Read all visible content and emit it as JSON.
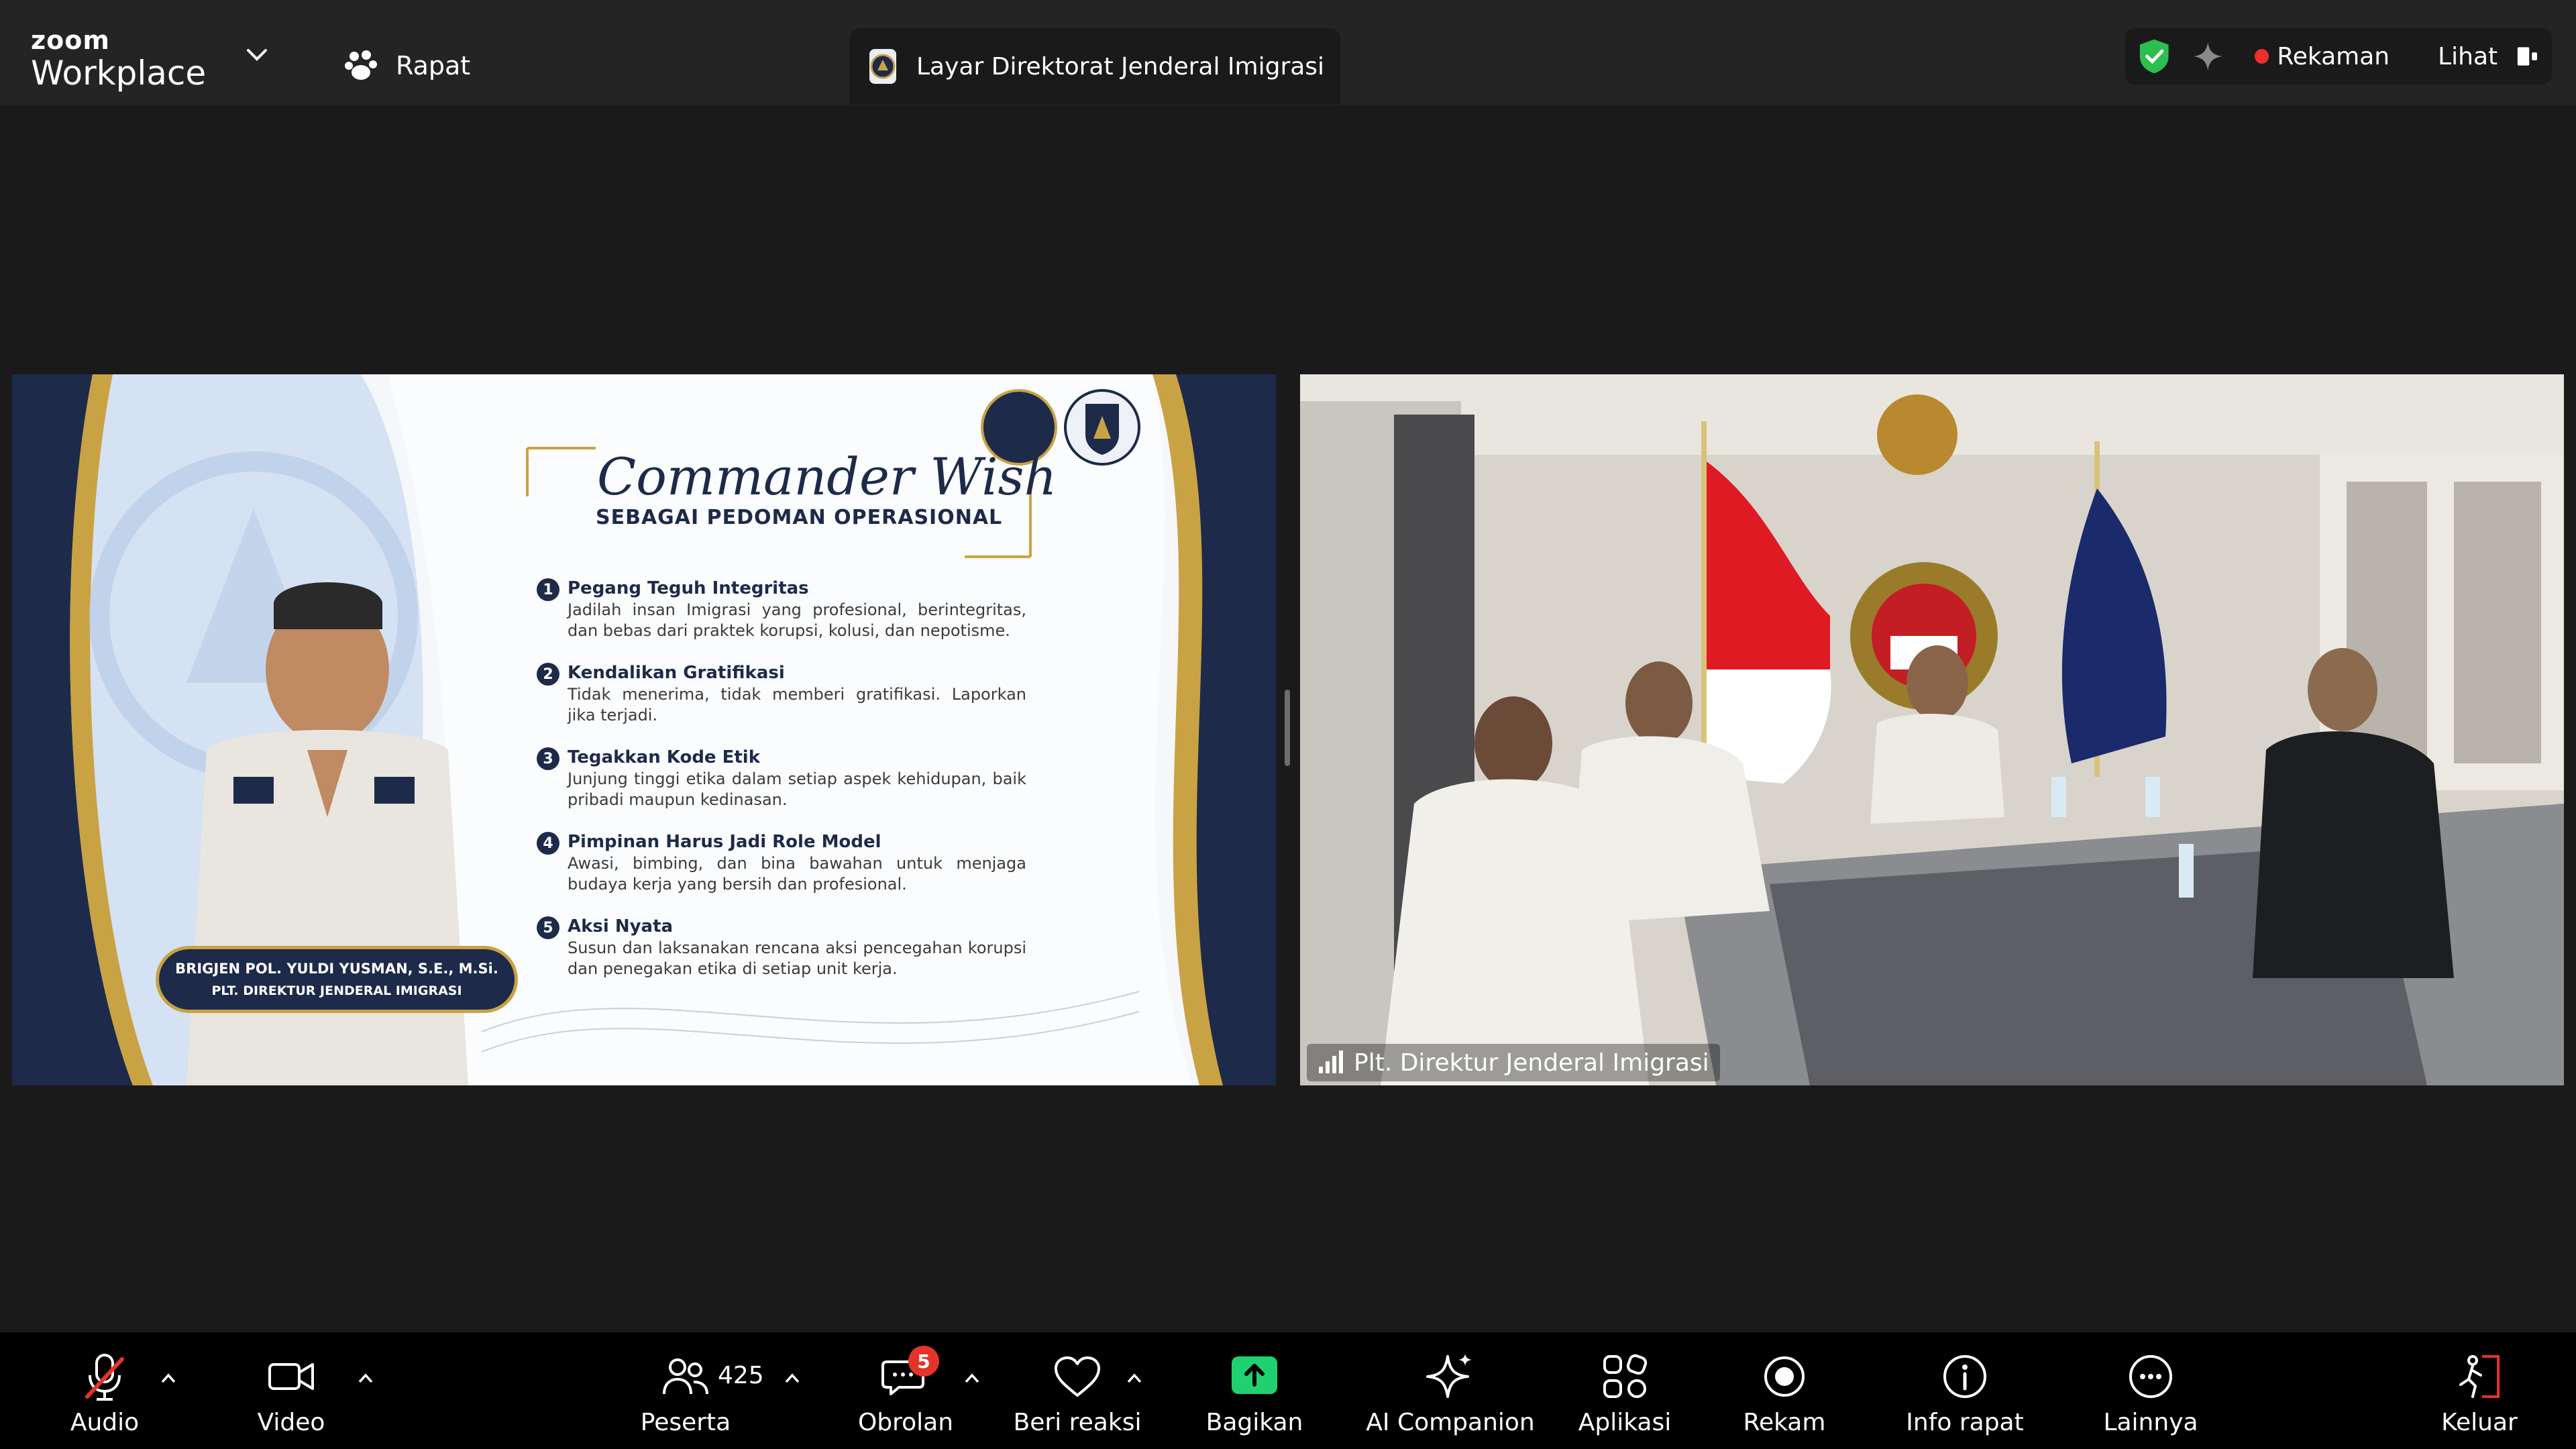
{
  "app": {
    "brand_top": "zoom",
    "brand_bottom": "Workplace",
    "meeting_label": "Rapat"
  },
  "share_tab": {
    "title": "Layar Direktorat Jenderal Imigrasi"
  },
  "status": {
    "recording_label": "Rekaman",
    "view_label": "Lihat",
    "recording_color": "#ee2d2d",
    "secure_color": "#2dbf4e"
  },
  "slide": {
    "title": "Commander Wish",
    "subtitle": "SEBAGAI PEDOMAN OPERASIONAL",
    "points": [
      {
        "num": "1",
        "title": "Pegang Teguh Integritas",
        "desc": "Jadilah insan Imigrasi yang profesional, berintegritas, dan bebas dari praktek korupsi, kolusi, dan nepotisme."
      },
      {
        "num": "2",
        "title": "Kendalikan Gratifikasi",
        "desc": "Tidak menerima, tidak memberi gratifikasi. Laporkan jika terjadi."
      },
      {
        "num": "3",
        "title": "Tegakkan Kode Etik",
        "desc": "Junjung tinggi etika dalam setiap aspek kehidupan, baik pribadi maupun kedinasan."
      },
      {
        "num": "4",
        "title": "Pimpinan Harus Jadi Role Model",
        "desc": "Awasi, bimbing, dan bina bawahan untuk menjaga budaya kerja yang bersih dan profesional."
      },
      {
        "num": "5",
        "title": "Aksi Nyata",
        "desc": "Susun dan laksanakan rencana aksi pencegahan korupsi dan penegakan etika di setiap unit kerja."
      }
    ],
    "officer_name": "BRIGJEN POL. YULDI YUSMAN, S.E., M.Si.",
    "officer_title": "PLT. DIREKTUR JENDERAL IMIGRASI",
    "navy": "#1d2a4a",
    "gold": "#c9a243"
  },
  "camera": {
    "participant_name": "Plt. Direktur Jenderal Imigrasi"
  },
  "toolbar": {
    "audio": "Audio",
    "video": "Video",
    "participants": "Peserta",
    "participants_count": "425",
    "chat": "Obrolan",
    "chat_badge": "5",
    "react": "Beri reaksi",
    "share": "Bagikan",
    "ai": "AI Companion",
    "apps": "Aplikasi",
    "record": "Rekam",
    "info": "Info rapat",
    "more": "Lainnya",
    "leave": "Keluar",
    "share_color": "#1fd16f",
    "leave_color": "#e5332a"
  }
}
